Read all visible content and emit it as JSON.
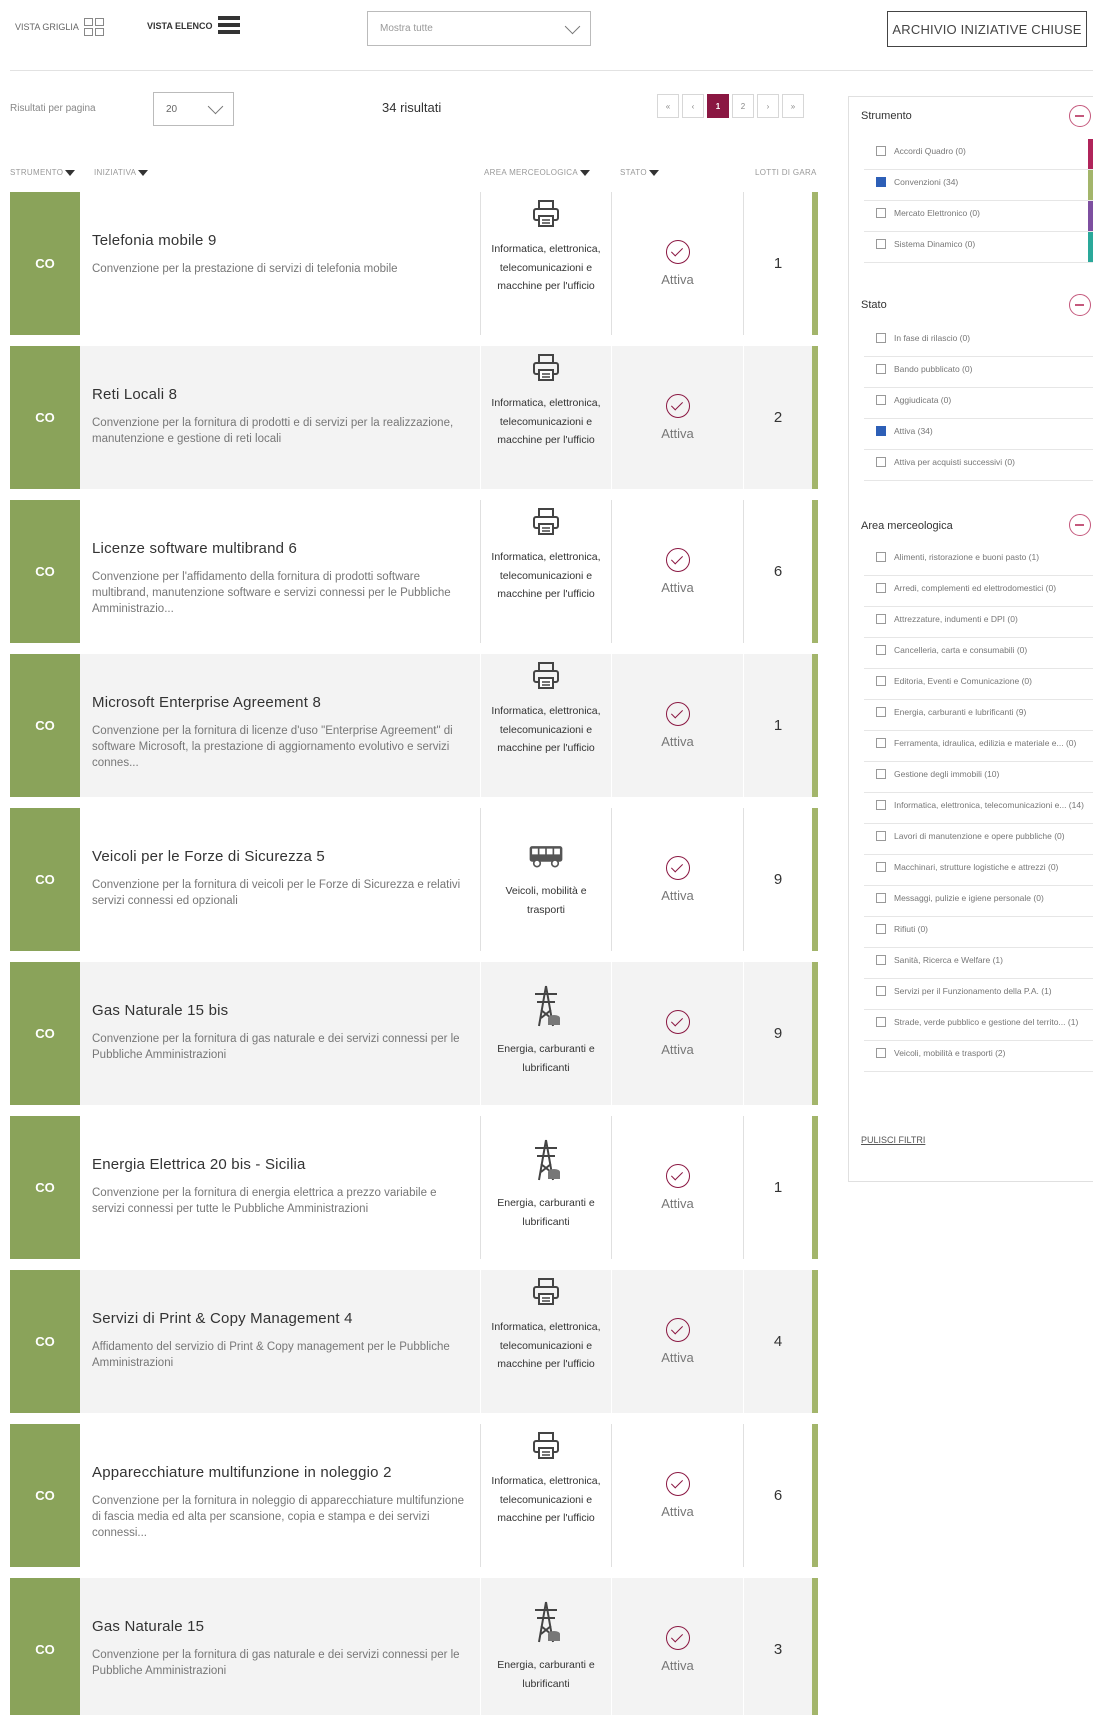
{
  "toolbar": {
    "grid_view_label": "VISTA GRIGLIA",
    "list_view_label": "VISTA ELENCO",
    "show_select_value": "Mostra tutte",
    "archive_button": "ARCHIVIO INIZIATIVE CHIUSE"
  },
  "results": {
    "per_page_label": "Risultati per pagina",
    "per_page_value": "20",
    "count_text": "34 risultati"
  },
  "pagination": [
    "«",
    "‹",
    "1",
    "2",
    "›",
    "»"
  ],
  "columns": {
    "strumento": "STRUMENTO",
    "iniziativa": "INIZIATIVA",
    "area": "AREA MERCEOLOGICA",
    "stato": "STATO",
    "lotti": "LOTTI DI GARA"
  },
  "rows": [
    {
      "tag": "CO",
      "title": "Telefonia mobile 9",
      "desc": "Convenzione per la prestazione di servizi di telefonia mobile",
      "area": "Informatica, elettronica, telecomunicazioni e macchine per l'ufficio",
      "icon": "printer-icon",
      "status": "Attiva",
      "lots": "1"
    },
    {
      "tag": "CO",
      "title": "Reti Locali 8",
      "desc": "Convenzione per la fornitura di prodotti e di servizi per la realizzazione, manutenzione e gestione di reti locali",
      "area": "Informatica, elettronica, telecomunicazioni e macchine per l'ufficio",
      "icon": "printer-icon",
      "status": "Attiva",
      "lots": "2"
    },
    {
      "tag": "CO",
      "title": "Licenze software multibrand 6",
      "desc": "Convenzione per l'affidamento della fornitura di prodotti software multibrand, manutenzione software e servizi connessi per le Pubbliche Amministrazio...",
      "area": "Informatica, elettronica, telecomunicazioni e macchine per l'ufficio",
      "icon": "printer-icon",
      "status": "Attiva",
      "lots": "6"
    },
    {
      "tag": "CO",
      "title": "Microsoft Enterprise Agreement 8",
      "desc": "Convenzione per la fornitura di licenze d'uso \"Enterprise Agreement\" di software Microsoft, la prestazione di aggiornamento evolutivo e servizi connes...",
      "area": "Informatica, elettronica, telecomunicazioni e macchine per l'ufficio",
      "icon": "printer-icon",
      "status": "Attiva",
      "lots": "1"
    },
    {
      "tag": "CO",
      "title": "Veicoli per le Forze di Sicurezza 5",
      "desc": "Convenzione per la fornitura di veicoli per le Forze di Sicurezza e relativi servizi connessi ed opzionali",
      "area": "Veicoli, mobilità e trasporti",
      "icon": "bus-icon",
      "status": "Attiva",
      "lots": "9"
    },
    {
      "tag": "CO",
      "title": "Gas Naturale 15 bis",
      "desc": "Convenzione per la fornitura di gas naturale e dei servizi connessi per le Pubbliche Amministrazioni",
      "area": "Energia, carburanti e lubrificanti",
      "icon": "power-pylon-icon",
      "status": "Attiva",
      "lots": "9"
    },
    {
      "tag": "CO",
      "title": "Energia Elettrica 20 bis - Sicilia",
      "desc": "Convenzione per la fornitura di energia elettrica a prezzo variabile e servizi connessi per tutte le Pubbliche Amministrazioni",
      "area": "Energia, carburanti e lubrificanti",
      "icon": "power-pylon-icon",
      "status": "Attiva",
      "lots": "1"
    },
    {
      "tag": "CO",
      "title": "Servizi di Print & Copy Management 4",
      "desc": "Affidamento del servizio di Print & Copy management per le Pubbliche Amministrazioni",
      "area": "Informatica, elettronica, telecomunicazioni e macchine per l'ufficio",
      "icon": "printer-icon",
      "status": "Attiva",
      "lots": "4"
    },
    {
      "tag": "CO",
      "title": "Apparecchiature multifunzione in noleggio 2",
      "desc": "Convenzione per la fornitura in noleggio di apparecchiature multifunzione di fascia media ed alta per scansione, copia e stampa e dei servizi connessi...",
      "area": "Informatica, elettronica, telecomunicazioni e macchine per l'ufficio",
      "icon": "printer-icon",
      "status": "Attiva",
      "lots": "6"
    },
    {
      "tag": "CO",
      "title": "Gas Naturale 15",
      "desc": "Convenzione per la fornitura di gas naturale e dei servizi connessi per le Pubbliche Amministrazioni",
      "area": "Energia, carburanti e lubrificanti",
      "icon": "power-pylon-icon",
      "status": "Attiva",
      "lots": "3"
    }
  ],
  "sidebar": {
    "strumento": {
      "title": "Strumento",
      "items": [
        {
          "label": "Accordi Quadro (0)",
          "checked": false,
          "color": "#b0245a"
        },
        {
          "label": "Convenzioni (34)",
          "checked": true,
          "color": "#a3b56b"
        },
        {
          "label": "Mercato Elettronico (0)",
          "checked": false,
          "color": "#7d4fa0"
        },
        {
          "label": "Sistema Dinamico (0)",
          "checked": false,
          "color": "#2aa89a"
        }
      ]
    },
    "stato": {
      "title": "Stato",
      "items": [
        {
          "label": "In fase di rilascio (0)",
          "checked": false
        },
        {
          "label": "Bando pubblicato (0)",
          "checked": false
        },
        {
          "label": "Aggiudicata (0)",
          "checked": false
        },
        {
          "label": "Attiva (34)",
          "checked": true
        },
        {
          "label": "Attiva per acquisti successivi (0)",
          "checked": false
        }
      ]
    },
    "area": {
      "title": "Area merceologica",
      "items": [
        {
          "label": "Alimenti, ristorazione e buoni pasto (1)"
        },
        {
          "label": "Arredi, complementi ed elettrodomestici (0)"
        },
        {
          "label": "Attrezzature, indumenti e DPI (0)"
        },
        {
          "label": "Cancelleria, carta e consumabili (0)"
        },
        {
          "label": "Editoria, Eventi e Comunicazione (0)"
        },
        {
          "label": "Energia, carburanti e lubrificanti (9)"
        },
        {
          "label": "Ferramenta, idraulica, edilizia e materiale e... (0)"
        },
        {
          "label": "Gestione degli immobili (10)"
        },
        {
          "label": "Informatica, elettronica, telecomunicazioni e... (14)"
        },
        {
          "label": "Lavori di manutenzione e opere pubbliche (0)"
        },
        {
          "label": "Macchinari, strutture logistiche e attrezzi (0)"
        },
        {
          "label": "Messaggi, pulizie e igiene personale (0)"
        },
        {
          "label": "Rifiuti (0)"
        },
        {
          "label": "Sanità, Ricerca e Welfare (1)"
        },
        {
          "label": "Servizi per il Funzionamento della P.A. (1)"
        },
        {
          "label": "Strade, verde pubblico e gestione del territo... (1)"
        },
        {
          "label": "Veicoli, mobilità e trasporti (2)"
        }
      ]
    },
    "clear_filters": "PULISCI FILTRI"
  },
  "colors": {
    "accent": "#8a1742",
    "tag_green": "#8aa35a",
    "row_border": "#a3b56b"
  }
}
